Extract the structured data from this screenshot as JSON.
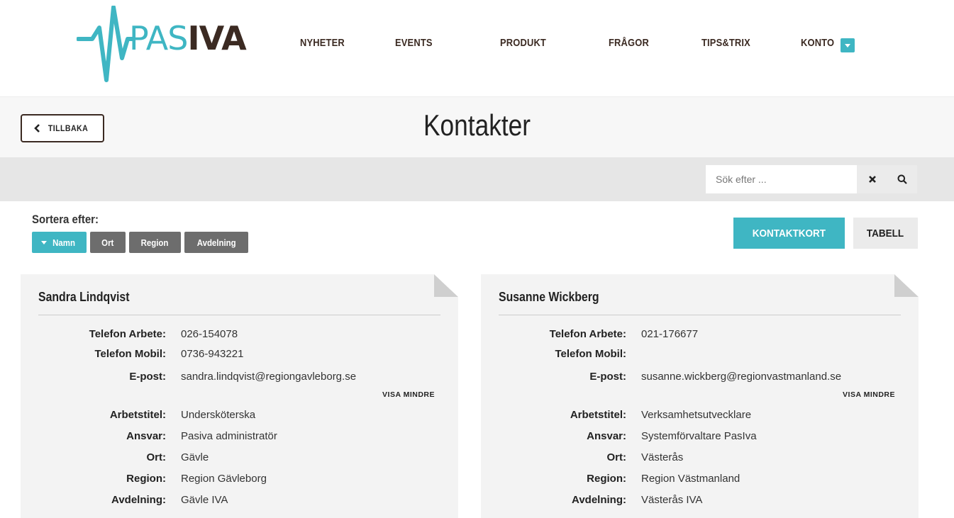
{
  "logo": {
    "part1": "PAS",
    "part2": "IVA"
  },
  "nav": {
    "items": [
      {
        "label": "NYHETER"
      },
      {
        "label": "EVENTS"
      },
      {
        "label": "PRODUKT"
      },
      {
        "label": "FRÅGOR"
      },
      {
        "label": "TIPS&TRIX"
      },
      {
        "label": "KONTO"
      }
    ]
  },
  "title_bar": {
    "back_label": "TILLBAKA",
    "title": "Kontakter"
  },
  "search": {
    "placeholder": "Sök efter ...",
    "value": ""
  },
  "sort": {
    "label": "Sortera efter:",
    "options": [
      {
        "label": "Namn",
        "active": true
      },
      {
        "label": "Ort",
        "active": false
      },
      {
        "label": "Region",
        "active": false
      },
      {
        "label": "Avdelning",
        "active": false
      }
    ]
  },
  "views": {
    "kontaktkort": "KONTAKTKORT",
    "tabell": "TABELL",
    "active": "kontaktkort"
  },
  "labels": {
    "telefon_arbete": "Telefon Arbete:",
    "telefon_mobil": "Telefon Mobil:",
    "epost": "E-post:",
    "visa_mindre": "VISA MINDRE",
    "arbetstitel": "Arbetstitel:",
    "ansvar": "Ansvar:",
    "ort": "Ort:",
    "region": "Region:",
    "avdelning": "Avdelning:"
  },
  "contacts": [
    {
      "name": "Sandra Lindqvist",
      "telefon_arbete": "026-154078",
      "telefon_mobil": "0736-943221",
      "epost": "sandra.lindqvist@regiongavleborg.se",
      "arbetstitel": "Undersköterska",
      "ansvar": "Pasiva administratör",
      "ort": "Gävle",
      "region": "Region Gävleborg",
      "avdelning": "Gävle IVA"
    },
    {
      "name": "Susanne Wickberg",
      "telefon_arbete": "021-176677",
      "telefon_mobil": "",
      "epost": "susanne.wickberg@regionvastmanland.se",
      "arbetstitel": "Verksamhetsutvecklare",
      "ansvar": "Systemförvaltare PasIva",
      "ort": "Västerås",
      "region": "Region Västmanland",
      "avdelning": "Västerås IVA"
    }
  ],
  "colors": {
    "accent": "#3fb6c3",
    "brand_dark": "#3b2a22",
    "sort_inactive": "#6d6d6d",
    "card_bg": "#f3f3f3"
  },
  "icons": {
    "back": "chevron-left-icon",
    "clear": "close-icon",
    "search": "search-icon",
    "konto": "caret-down-icon"
  }
}
